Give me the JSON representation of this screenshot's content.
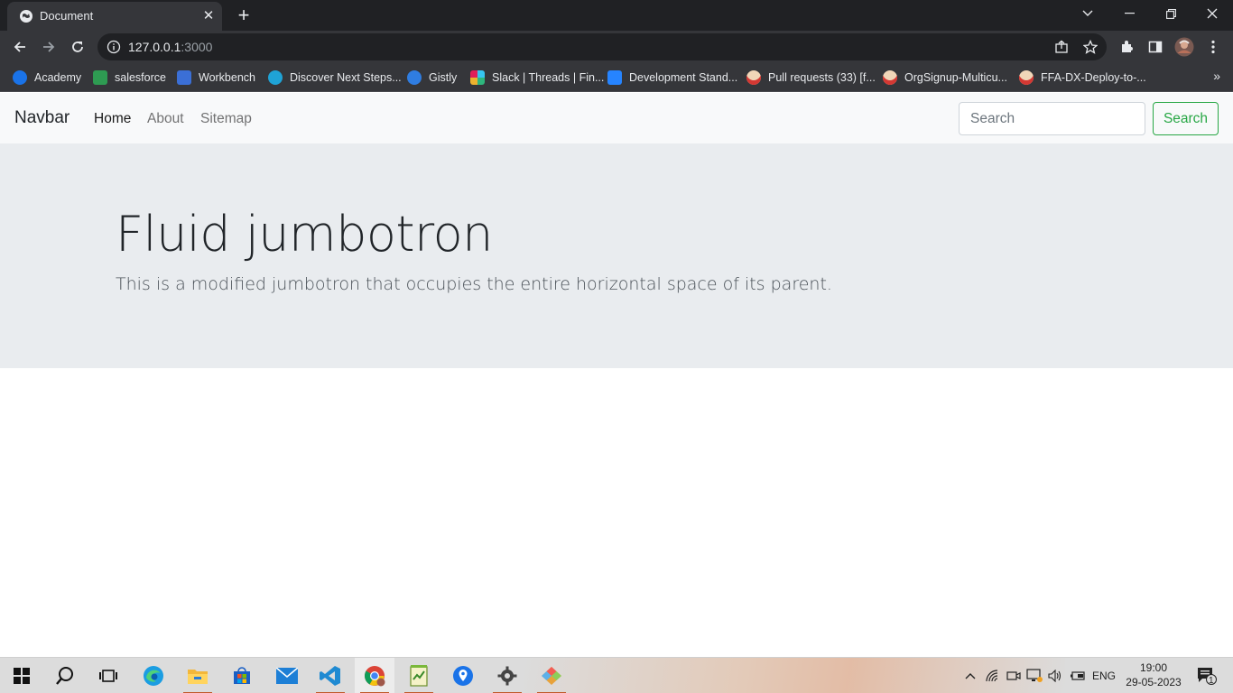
{
  "browser": {
    "tab": {
      "title": "Document",
      "close": "✕"
    },
    "new_tab": "+",
    "url_host": "127.0.0.1",
    "url_port": ":3000",
    "bookmarks": [
      {
        "label": "Academy",
        "icon": "academy-icon",
        "color": "#1a73e8"
      },
      {
        "label": "salesforce",
        "icon": "salesforce-icon",
        "color": "#2e9b52"
      },
      {
        "label": "Workbench",
        "icon": "workbench-cube-icon",
        "color": "#3b6fd6"
      },
      {
        "label": "Discover Next Steps...",
        "icon": "trailhead-icon",
        "color": "#1fa3d6"
      },
      {
        "label": "Gistly",
        "icon": "gistly-icon",
        "color": "#2f7de1"
      },
      {
        "label": "Slack | Threads | Fin...",
        "icon": "slack-icon",
        "color": "#e01e5a"
      },
      {
        "label": "Development Stand...",
        "icon": "confluence-icon",
        "color": "#2684ff"
      },
      {
        "label": "Pull requests (33) [f...",
        "icon": "jenkins-icon",
        "color": "#d33833"
      },
      {
        "label": "OrgSignup-Multicu...",
        "icon": "jenkins-icon",
        "color": "#d33833"
      },
      {
        "label": "FFA-DX-Deploy-to-...",
        "icon": "jenkins-icon",
        "color": "#d33833"
      }
    ],
    "bookmarks_more": "»"
  },
  "navbar": {
    "brand": "Navbar",
    "links": [
      {
        "label": "Home",
        "active": true
      },
      {
        "label": "About",
        "active": false
      },
      {
        "label": "Sitemap",
        "active": false
      }
    ],
    "search_placeholder": "Search",
    "search_button": "Search"
  },
  "jumbotron": {
    "title": "Fluid jumbotron",
    "lead": "This is a modified jumbotron that occupies the entire horizontal space of its parent."
  },
  "taskbar": {
    "language": "ENG",
    "time": "19:00",
    "date": "29-05-2023",
    "notifications": "1"
  },
  "colors": {
    "chrome_dark": "#202124",
    "chrome_toolbar": "#35363a",
    "navbar_bg": "#f8f9fa",
    "jumbotron_bg": "#e9ecef",
    "success": "#28a745"
  }
}
